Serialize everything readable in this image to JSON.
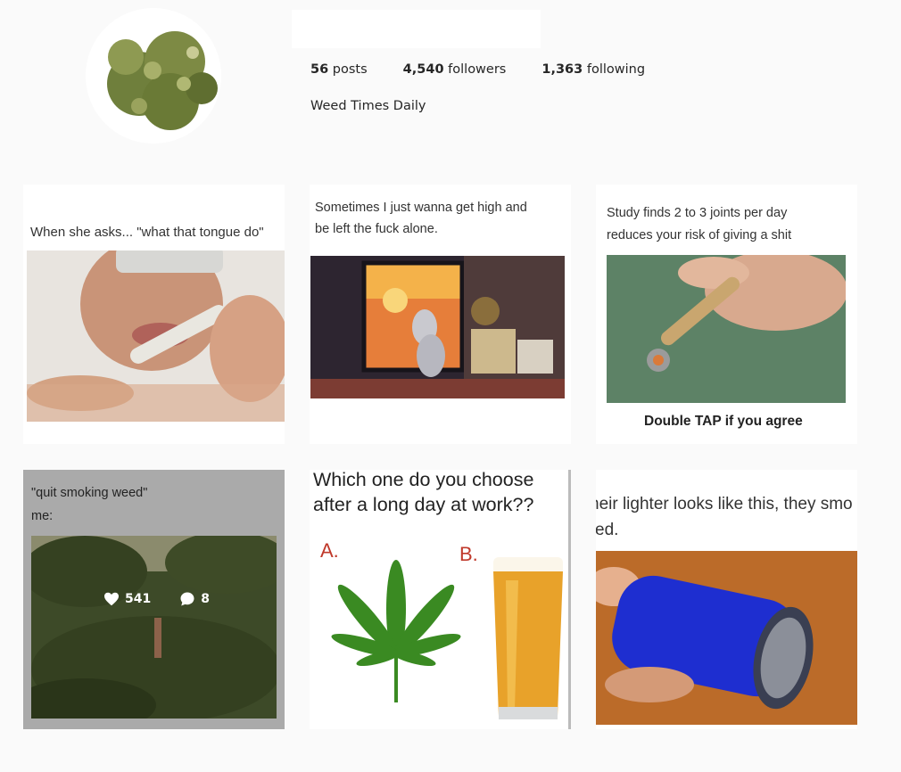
{
  "profile": {
    "username": "",
    "posts_count": "56",
    "posts_label": " posts",
    "followers_count": "4,540",
    "followers_label": " followers",
    "following_count": "1,363",
    "following_label": " following",
    "bio": "Weed Times Daily"
  },
  "posts": [
    {
      "caption": "When she asks... \"what that tongue do\""
    },
    {
      "caption_line1": "Sometimes I just wanna get high and",
      "caption_line2": "be left the fuck alone."
    },
    {
      "caption_line1": "Study finds 2 to 3 joints per day",
      "caption_line2": "reduces your risk of giving a shit",
      "footer": "Double TAP if you agree"
    },
    {
      "caption_line1": "\"quit smoking weed\"",
      "caption_line2": "me:",
      "likes": "541",
      "comments": "8"
    },
    {
      "caption_line1": "Which one do you choose",
      "caption_line2": "after a long day at work??",
      "option_a": "A.",
      "option_b": "B."
    },
    {
      "caption_line1": "heir lighter looks like this, they smo",
      "caption_line2": "ed."
    }
  ]
}
